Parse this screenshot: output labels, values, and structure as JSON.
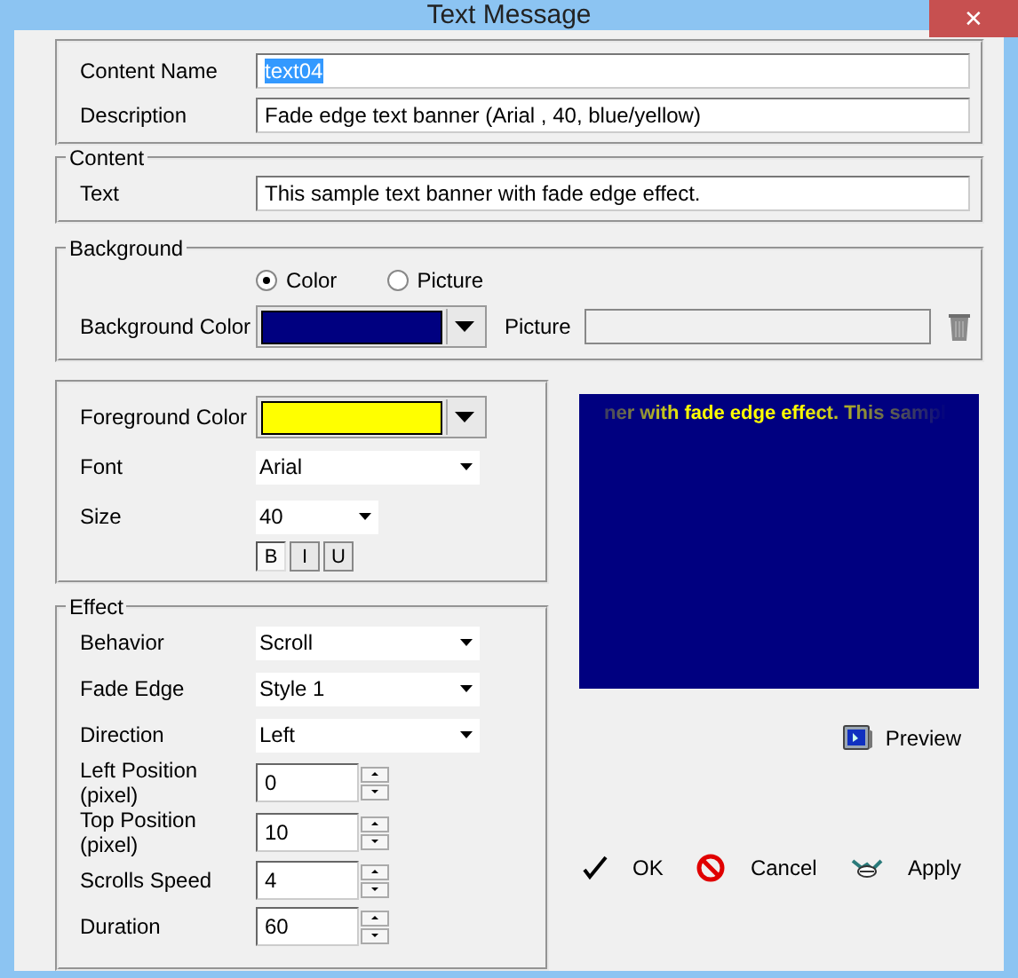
{
  "window": {
    "title": "Text Message",
    "close": "✕"
  },
  "general": {
    "rows": [
      {
        "label": "Content Name",
        "value": "text04",
        "highlighted": true
      },
      {
        "label": "Description",
        "value": "Fade edge text banner (Arial , 40, blue/yellow)",
        "highlighted": false
      }
    ]
  },
  "content": {
    "legend": "Content",
    "label": "Text",
    "value": "This sample text banner with fade edge effect."
  },
  "background": {
    "legend": "Background",
    "options": [
      {
        "label": "Color",
        "selected": true
      },
      {
        "label": "Picture",
        "selected": false
      }
    ],
    "color_label": "Background Color",
    "color": "#000080",
    "picture_label": "Picture",
    "picture_enabled": false
  },
  "foreground": {
    "color_label": "Foreground Color",
    "color": "#ffff00",
    "font_label": "Font",
    "font": "Arial",
    "size_label": "Size",
    "size": "40",
    "styles": [
      {
        "label": "B",
        "selected": true
      },
      {
        "label": "I",
        "selected": false
      },
      {
        "label": "U",
        "selected": false
      }
    ]
  },
  "effect": {
    "legend": "Effect",
    "rows": [
      {
        "kind": "select",
        "label": "Behavior",
        "value": "Scroll"
      },
      {
        "kind": "select",
        "label": "Fade Edge",
        "value": "Style 1"
      },
      {
        "kind": "select",
        "label": "Direction",
        "value": "Left"
      },
      {
        "kind": "spin",
        "label": "Left Position (pixel)",
        "value": "0"
      },
      {
        "kind": "spin",
        "label": "Top Position (pixel)",
        "value": "10"
      },
      {
        "kind": "spin",
        "label": "Scrolls Speed",
        "value": "4"
      },
      {
        "kind": "spin",
        "label": "Duration",
        "value": "60"
      }
    ]
  },
  "preview": {
    "text": "ner with fade edge effect. This sampl",
    "button": "Preview"
  },
  "actions": [
    {
      "kind": "ok",
      "label": "OK"
    },
    {
      "kind": "cancel",
      "label": "Cancel"
    },
    {
      "kind": "apply",
      "label": "Apply"
    }
  ]
}
